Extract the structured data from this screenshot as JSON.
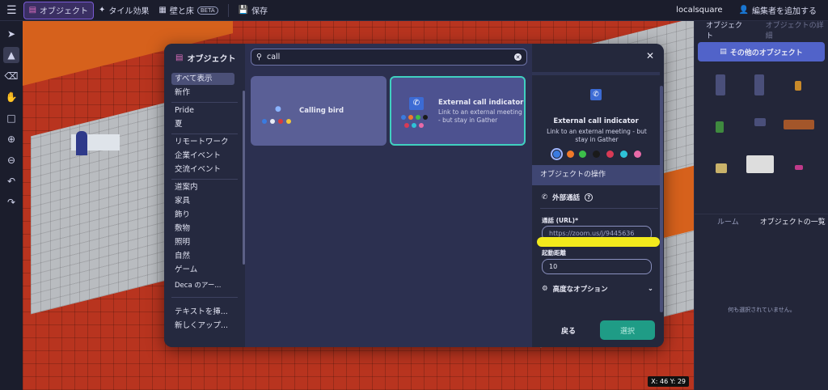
{
  "topbar": {
    "objects_tab": "オブジェクト",
    "tile_effects": "タイル効果",
    "walls_floors": "壁と床",
    "beta": "BETA",
    "save": "保存",
    "space_name": "localsquare",
    "add_editor": "編集者を追加する"
  },
  "right_panel": {
    "tab_objects": "オブジェクト",
    "tab_details": "オブジェクトの詳細",
    "other_objects_button": "その他のオブジェクト",
    "tab_room": "ルーム",
    "tab_object_list": "オブジェクトの一覧",
    "empty_text": "何も選択されていません。"
  },
  "canvas": {
    "coord_x": "X: 46",
    "coord_y": "Y: 29"
  },
  "modal": {
    "title": "オブジェクト",
    "categories": [
      {
        "label": "すべて表示",
        "active": true
      },
      {
        "label": "新作"
      },
      {
        "label": "Pride"
      },
      {
        "label": "夏"
      },
      {
        "label": "リモートワーク"
      },
      {
        "label": "企業イベント"
      },
      {
        "label": "交流イベント"
      },
      {
        "label": "道案内"
      },
      {
        "label": "家具"
      },
      {
        "label": "飾り"
      },
      {
        "label": "敷物"
      },
      {
        "label": "照明"
      },
      {
        "label": "自然"
      },
      {
        "label": "ゲーム"
      },
      {
        "label": "Deca のアー..."
      },
      {
        "label": "テキストを挿..."
      },
      {
        "label": "新しくアップ..."
      }
    ],
    "search": {
      "value": "call"
    },
    "cards": [
      {
        "name": "Calling bird",
        "description": "",
        "colors": [
          "#3a7be0",
          "#e9ecf5",
          "#d83a3a",
          "#f2c83a"
        ]
      },
      {
        "name": "External call indicator",
        "description": "Link to an external meeting - but stay in Gather",
        "colors": [
          "#3a7be0",
          "#f07a2a",
          "#3cbf4a",
          "#1a1a1a",
          "#d83a55",
          "#2ec3d8",
          "#e86aa8"
        ]
      }
    ],
    "detail": {
      "name": "External call indicator",
      "description": "Link to an external meeting - but stay in Gather",
      "colors": [
        "#3a7be0",
        "#f07a2a",
        "#3cbf4a",
        "#1a1a1a",
        "#d83a55",
        "#2ec3d8",
        "#e86aa8"
      ],
      "operations_header": "オブジェクトの操作",
      "external_call": "外部通話",
      "url_label": "通話 (URL)*",
      "url_placeholder": "https://zoom.us/j/9445636",
      "distance_label": "起動距離",
      "distance_value": "10",
      "advanced": "高度なオプション",
      "back": "戻る",
      "select": "選択"
    }
  }
}
